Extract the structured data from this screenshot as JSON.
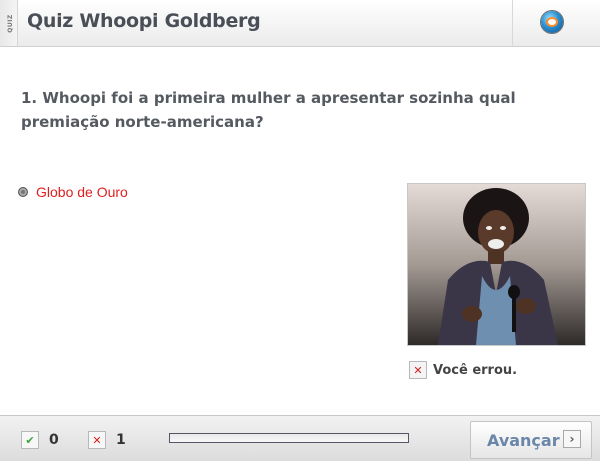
{
  "header": {
    "side_label": "QUIZ",
    "title": "Quiz Whoopi Goldberg",
    "logo_icon": "globo-logo"
  },
  "question": {
    "text": "1. Whoopi foi a primeira mulher a apresentar sozinha qual premiação norte-americana?"
  },
  "options": [
    {
      "label": "Globo de Ouro",
      "color": "#e02020"
    }
  ],
  "photo": {
    "alt": "Whoopi Goldberg"
  },
  "feedback": {
    "icon": "x-icon",
    "text": "Você errou."
  },
  "footer": {
    "correct": {
      "icon": "check-icon",
      "value": "0"
    },
    "wrong": {
      "icon": "x-icon",
      "value": "1"
    },
    "progress": 0,
    "next_label": "Avançar",
    "next_icon": "chevron-right-icon"
  },
  "colors": {
    "title": "#4a4f57",
    "option": "#e02020",
    "next_label": "#6a86a8",
    "progress": "#3a72b8"
  }
}
